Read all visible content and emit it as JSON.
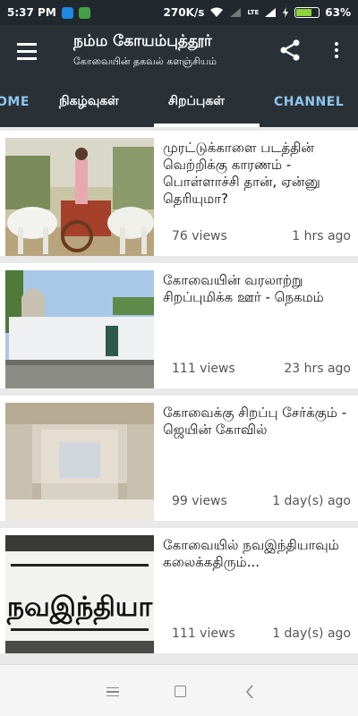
{
  "status_bar": {
    "time": "5:37 PM",
    "network_speed": "270K/s",
    "battery": "63%",
    "battery_level": 0.63,
    "lte_label": "LTE"
  },
  "toolbar": {
    "title": "நம்ம கோயம்புத்தூர்",
    "subtitle": "கோவையின் தகவல் களஞ்சியம்",
    "menu_icon": "hamburger-menu-icon",
    "share_icon": "share-icon",
    "more_icon": "more-vert-icon"
  },
  "tabs": [
    {
      "label": "OME"
    },
    {
      "label": "நிகழ்வுகள்"
    },
    {
      "label": "சிறப்புகள்",
      "selected": true
    },
    {
      "label": "CHANNEL"
    }
  ],
  "articles": [
    {
      "title": "முரட்டுக்காளை படத்தின் வெற்றிக்கு காரணம் - பொள்ளாச்சி தான், ஏன்னு தெரியுமா?",
      "views": "76 views",
      "time": "1 hrs ago"
    },
    {
      "title": "கோவையின் வரலாற்று சிறப்புமிக்க ஊர் - நெகமம்",
      "views": "111 views",
      "time": "23 hrs ago"
    },
    {
      "title": "கோவைக்கு சிறப்பு சேர்க்கும் - ஜெயின் கோவில்",
      "views": "99 views",
      "time": "1 day(s) ago"
    },
    {
      "title": "கோவையில் நவஇந்தியாவும் கலைக்கதிரும்...",
      "views": "111 views",
      "time": "1 day(s) ago"
    }
  ],
  "newspaper_logo_text": "நவஇந்தியா",
  "colors": {
    "app_bar": "#2a3136",
    "status_bar": "#22292e",
    "tab_accent": "#8ec6f0",
    "battery_green": "#8bd23b"
  }
}
